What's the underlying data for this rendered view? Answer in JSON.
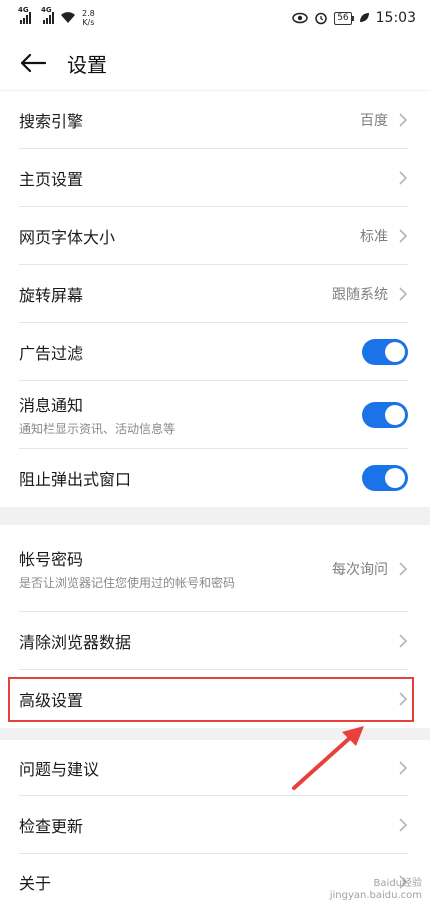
{
  "status_bar": {
    "signal1": "4G",
    "signal2": "4G",
    "speed_value": "2.8",
    "speed_unit": "K/s",
    "battery": "56",
    "time": "15:03"
  },
  "header": {
    "title": "设置"
  },
  "group1": [
    {
      "label": "搜索引擎",
      "value": "百度",
      "type": "link"
    },
    {
      "label": "主页设置",
      "value": "",
      "type": "link"
    },
    {
      "label": "网页字体大小",
      "value": "标准",
      "type": "link"
    },
    {
      "label": "旋转屏幕",
      "value": "跟随系统",
      "type": "link"
    },
    {
      "label": "广告过滤",
      "type": "toggle",
      "on": true
    },
    {
      "label": "消息通知",
      "sub": "通知栏显示资讯、活动信息等",
      "type": "toggle",
      "on": true
    },
    {
      "label": "阻止弹出式窗口",
      "type": "toggle",
      "on": true
    }
  ],
  "group2": [
    {
      "label": "帐号密码",
      "sub": "是否让浏览器记住您使用过的帐号和密码",
      "value": "每次询问",
      "type": "link"
    },
    {
      "label": "清除浏览器数据",
      "type": "link"
    },
    {
      "label": "高级设置",
      "type": "link"
    }
  ],
  "group3": [
    {
      "label": "问题与建议",
      "type": "link"
    },
    {
      "label": "检查更新",
      "type": "link"
    },
    {
      "label": "关于",
      "type": "link"
    }
  ],
  "colors": {
    "accent": "#1a73e8",
    "highlight": "#e8413c"
  },
  "watermark": {
    "line1": "Baidu经验",
    "line2": "jingyan.baidu.com"
  }
}
